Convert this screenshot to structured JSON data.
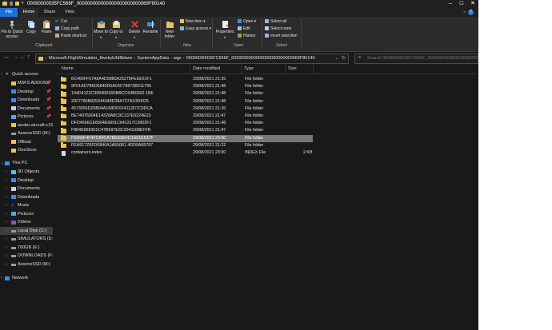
{
  "window": {
    "title": "00090000035FC566F_000000000000000000000000069F80140",
    "tabs": [
      "File",
      "Home",
      "Share",
      "View"
    ],
    "help": "?"
  },
  "ribbon": {
    "clipboard": {
      "pin": "Pin to Quick access",
      "copy": "Copy",
      "paste": "Paste",
      "cut": "Cut",
      "copy_path": "Copy path",
      "paste_shortcut": "Paste shortcut",
      "label": "Clipboard"
    },
    "organize": {
      "move_to": "Move to",
      "copy_to": "Copy to",
      "delete": "Delete",
      "rename": "Rename",
      "label": "Organize"
    },
    "new": {
      "new_folder": "New folder",
      "new_item": "New item",
      "easy_access": "Easy access",
      "label": "New"
    },
    "open": {
      "properties": "Properties",
      "open": "Open",
      "edit": "Edit",
      "history": "History",
      "label": "Open"
    },
    "select": {
      "select_all": "Select all",
      "select_none": "Select none",
      "invert": "Invert selection",
      "label": "Select"
    }
  },
  "address": {
    "crumbs": [
      "Microsoft.FlightSimulator_8wekyb3d8bbwe",
      "SystemAppData",
      "wgs",
      "00090000035FC566F_0000000000000000000000000069F80140"
    ],
    "search_placeholder": "Search 00090000035FC566F_000000000000000000000000069F80140"
  },
  "columns": {
    "name": "Name",
    "date": "Date modified",
    "type": "Type",
    "size": "Size"
  },
  "files": [
    {
      "name": "6C460FF57A6A4D5880A25275FEEE61F1",
      "date": "29/08/2021 21:26",
      "type": "File folder",
      "size": ""
    },
    {
      "name": "9F01AD7B6D5840D5A03C79873B911795",
      "date": "29/08/2021 21:48",
      "type": "File folder",
      "size": ""
    },
    {
      "name": "194D4122C39945818DBBCC64B0002 1BE",
      "date": "29/08/2021 21:48",
      "type": "File folder",
      "size": ""
    },
    {
      "name": "2927780B825344348D38A727A1050025",
      "date": "29/08/2021 21:48",
      "type": "File folder",
      "size": ""
    },
    {
      "name": "4573956D25B04A168DFFF4112D7C0DCA",
      "date": "29/08/2021 21:26",
      "type": "File folder",
      "size": ""
    },
    {
      "name": "BE74076004E14328A8C9C137E5224E23",
      "date": "29/08/2021 21:47",
      "type": "File folder",
      "size": ""
    },
    {
      "name": "DFD4566CE6504E6691C641317C3902F1",
      "date": "29/08/2021 21:48",
      "type": "File folder",
      "size": ""
    },
    {
      "name": "F864B958301C47B697E3C3341108EFFB",
      "date": "29/08/2021 21:47",
      "type": "File folder",
      "size": ""
    },
    {
      "name": "F6365F4F4FC84CA7BEE5EFD1A01E537F",
      "date": "29/08/2021 23:00",
      "type": "File folder",
      "size": ""
    },
    {
      "name": "FEA917Z6FD0840A1A55061 4DD5A65787",
      "date": "29/08/2021 21:22",
      "type": "File folder",
      "size": ""
    },
    {
      "name": "containers.index",
      "date": "29/08/2021 23:00",
      "type": "INDEX File",
      "size": "2 KB"
    }
  ],
  "nav": {
    "quick_access": "Quick access",
    "items": [
      "MSFS ADDONS",
      "Desktop",
      "Downloads",
      "Documents",
      "Pictures",
      "asobo-aircraft-c152",
      "AssenoSSD (M:)",
      "Official",
      "OneStore"
    ],
    "this_pc": "This PC",
    "pc_items": [
      "3D Objects",
      "Desktop",
      "Documents",
      "Downloads",
      "Music",
      "Pictures",
      "Videos",
      "Local Disk (C:)",
      "SIMULATORS (D:)",
      "700GB (E:)",
      "DOWNLOADS (F:)",
      "AssenoSSD (M:)"
    ],
    "network": "Network"
  },
  "colors": {
    "accent": "#1a73d9",
    "folder": "#e8c35a",
    "selected_row": "#777777",
    "background": "#191919"
  }
}
